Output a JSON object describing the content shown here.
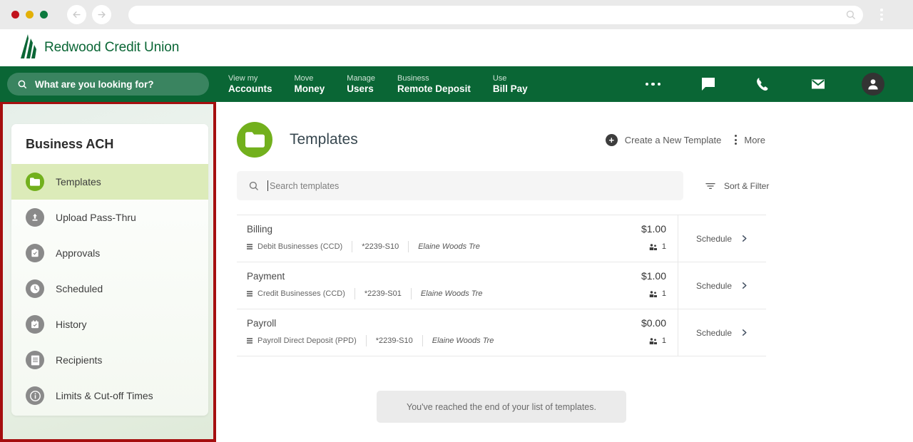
{
  "browser": {
    "traffic_lights": [
      "close",
      "minimize",
      "maximize"
    ],
    "back_icon": "back-arrow-icon",
    "forward_icon": "forward-arrow-icon",
    "url_value": "",
    "url_search_icon": "search-icon",
    "menu_icon": "kebab-menu-icon"
  },
  "brand": {
    "name": "Redwood Credit Union",
    "logo_icon": "redwood-tree-logo",
    "color": "#0a6635"
  },
  "topnav": {
    "search": {
      "placeholder": "What are you looking for?",
      "value": "",
      "icon": "search-icon"
    },
    "links": [
      {
        "top": "View my",
        "bottom": "Accounts"
      },
      {
        "top": "Move",
        "bottom": "Money"
      },
      {
        "top": "Manage",
        "bottom": "Users"
      },
      {
        "top": "Business",
        "bottom": "Remote Deposit"
      },
      {
        "top": "Use",
        "bottom": "Bill Pay"
      }
    ],
    "icons": [
      {
        "name": "more-options-icon",
        "label": "More"
      },
      {
        "name": "chat-message-icon",
        "label": "Messages"
      },
      {
        "name": "phone-icon",
        "label": "Call"
      },
      {
        "name": "mail-envelope-icon",
        "label": "Mail"
      },
      {
        "name": "user-avatar-icon",
        "label": "Profile"
      }
    ],
    "bg_color": "#0a6635"
  },
  "sidebar": {
    "title": "Business ACH",
    "highlight_color": "#a50f0f",
    "items": [
      {
        "label": "Templates",
        "icon": "folder-icon",
        "active": true
      },
      {
        "label": "Upload Pass-Thru",
        "icon": "upload-icon",
        "active": false
      },
      {
        "label": "Approvals",
        "icon": "clipboard-check-icon",
        "active": false
      },
      {
        "label": "Scheduled",
        "icon": "clock-icon",
        "active": false
      },
      {
        "label": "History",
        "icon": "calendar-check-icon",
        "active": false
      },
      {
        "label": "Recipients",
        "icon": "list-document-icon",
        "active": false
      },
      {
        "label": "Limits & Cut-off Times",
        "icon": "info-icon",
        "active": false
      }
    ]
  },
  "main": {
    "page_icon": "folder-icon",
    "page_title": "Templates",
    "accent_color": "#72b01d",
    "actions": [
      {
        "label": "Create a New Template",
        "icon": "plus-circle-icon"
      },
      {
        "label": "More",
        "icon": "kebab-menu-icon"
      }
    ],
    "search": {
      "placeholder": "Search templates",
      "value": "",
      "icon": "search-icon"
    },
    "sort_filter": {
      "label": "Sort & Filter",
      "icon": "filter-icon"
    },
    "templates": [
      {
        "name": "Billing",
        "amount": "$1.00",
        "type": "Debit Businesses (CCD)",
        "account": "*2239-S10",
        "owner": "Elaine Woods Tre",
        "recipients": "1",
        "action": "Schedule"
      },
      {
        "name": "Payment",
        "amount": "$1.00",
        "type": "Credit Businesses (CCD)",
        "account": "*2239-S01",
        "owner": "Elaine Woods Tre",
        "recipients": "1",
        "action": "Schedule"
      },
      {
        "name": "Payroll",
        "amount": "$0.00",
        "type": "Payroll Direct Deposit (PPD)",
        "account": "*2239-S10",
        "owner": "Elaine Woods Tre",
        "recipients": "1",
        "action": "Schedule"
      }
    ],
    "end_note": "You've reached the end of your list of templates."
  }
}
